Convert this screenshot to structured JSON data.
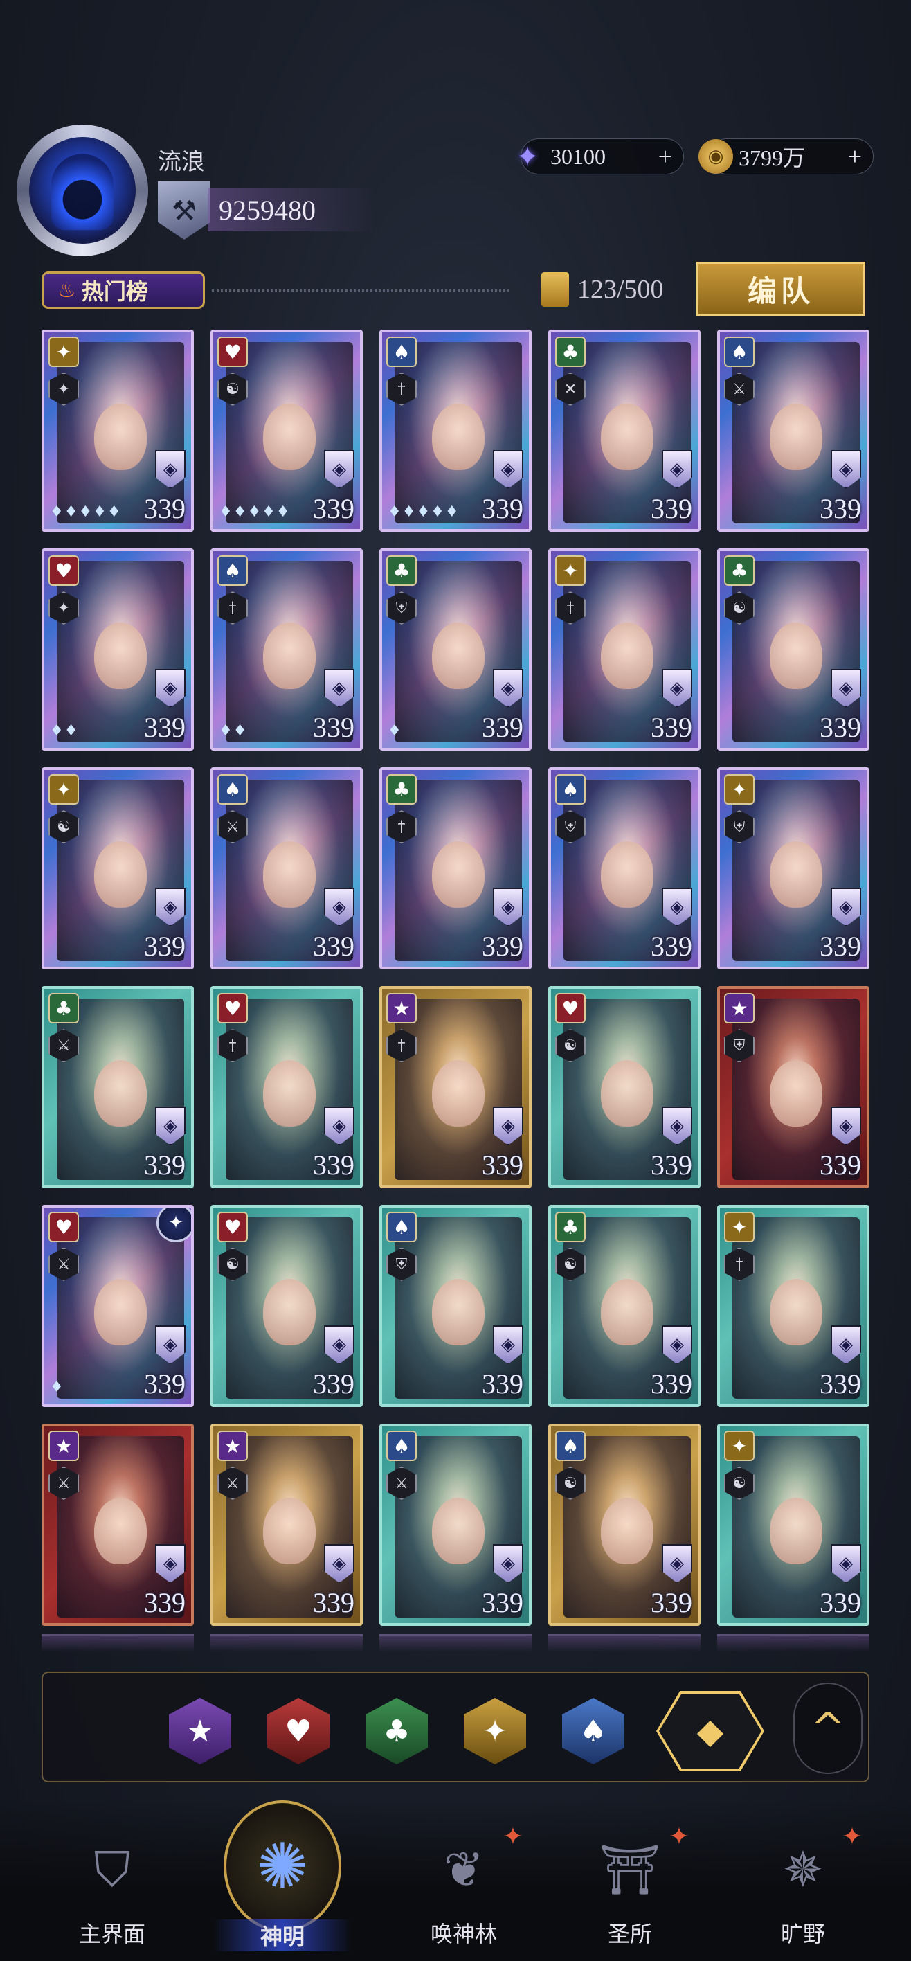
{
  "player": {
    "name": "流浪",
    "power": "9259480",
    "avatar_icon": "hooded-figure"
  },
  "currencies": {
    "crystal": {
      "value": "30100",
      "icon": "crystal-star",
      "plus": "+"
    },
    "gold": {
      "value": "3799万",
      "icon": "gold-coin",
      "plus": "+"
    }
  },
  "toolbar": {
    "hot_label": "热门榜",
    "card_count": "123/500",
    "team_button": "编队"
  },
  "cards": [
    {
      "suit": "diamond",
      "glyph": "✦",
      "frame": "holo",
      "level": "339",
      "pips": "♦♦♦♦♦",
      "cls": "✦"
    },
    {
      "suit": "heart",
      "glyph": "♥",
      "frame": "holo",
      "level": "339",
      "pips": "♦♦♦♦♦",
      "cls": "☯"
    },
    {
      "suit": "spade",
      "glyph": "♠",
      "frame": "holo",
      "level": "339",
      "pips": "♦♦♦♦♦",
      "cls": "†"
    },
    {
      "suit": "club",
      "glyph": "♣",
      "frame": "holo",
      "level": "339",
      "pips": "",
      "cls": "✕"
    },
    {
      "suit": "spade",
      "glyph": "♠",
      "frame": "holo",
      "level": "339",
      "pips": "",
      "cls": "⚔"
    },
    {
      "suit": "heart",
      "glyph": "♥",
      "frame": "holo",
      "level": "339",
      "pips": "♦♦",
      "cls": "✦"
    },
    {
      "suit": "spade",
      "glyph": "♠",
      "frame": "holo",
      "level": "339",
      "pips": "♦♦",
      "cls": "†"
    },
    {
      "suit": "club",
      "glyph": "♣",
      "frame": "holo",
      "level": "339",
      "pips": "♦",
      "cls": "⛨"
    },
    {
      "suit": "diamond",
      "glyph": "✦",
      "frame": "holo",
      "level": "339",
      "pips": "",
      "cls": "†"
    },
    {
      "suit": "club",
      "glyph": "♣",
      "frame": "holo",
      "level": "339",
      "pips": "",
      "cls": "☯"
    },
    {
      "suit": "diamond",
      "glyph": "✦",
      "frame": "holo",
      "level": "339",
      "pips": "",
      "cls": "☯"
    },
    {
      "suit": "spade",
      "glyph": "♠",
      "frame": "holo",
      "level": "339",
      "pips": "",
      "cls": "⚔"
    },
    {
      "suit": "club",
      "glyph": "♣",
      "frame": "holo",
      "level": "339",
      "pips": "",
      "cls": "†"
    },
    {
      "suit": "spade",
      "glyph": "♠",
      "frame": "holo",
      "level": "339",
      "pips": "",
      "cls": "⛨"
    },
    {
      "suit": "diamond",
      "glyph": "✦",
      "frame": "holo",
      "level": "339",
      "pips": "",
      "cls": "⛨"
    },
    {
      "suit": "club",
      "glyph": "♣",
      "frame": "teal",
      "level": "339",
      "pips": "",
      "cls": "⚔"
    },
    {
      "suit": "heart",
      "glyph": "♥",
      "frame": "teal",
      "level": "339",
      "pips": "",
      "cls": "†"
    },
    {
      "suit": "star",
      "glyph": "★",
      "frame": "gold",
      "level": "339",
      "pips": "",
      "cls": "†"
    },
    {
      "suit": "heart",
      "glyph": "♥",
      "frame": "teal",
      "level": "339",
      "pips": "",
      "cls": "☯"
    },
    {
      "suit": "star",
      "glyph": "★",
      "frame": "red",
      "level": "339",
      "pips": "",
      "cls": "⛨"
    },
    {
      "suit": "heart",
      "glyph": "♥",
      "frame": "holo",
      "level": "339",
      "pips": "♦",
      "cls": "⚔",
      "badge": "✦"
    },
    {
      "suit": "heart",
      "glyph": "♥",
      "frame": "teal",
      "level": "339",
      "pips": "",
      "cls": "☯"
    },
    {
      "suit": "spade",
      "glyph": "♠",
      "frame": "teal",
      "level": "339",
      "pips": "",
      "cls": "⛨"
    },
    {
      "suit": "club",
      "glyph": "♣",
      "frame": "teal",
      "level": "339",
      "pips": "",
      "cls": "☯"
    },
    {
      "suit": "diamond",
      "glyph": "✦",
      "frame": "teal",
      "level": "339",
      "pips": "",
      "cls": "†"
    },
    {
      "suit": "star",
      "glyph": "★",
      "frame": "red",
      "level": "339",
      "pips": "",
      "cls": "⚔"
    },
    {
      "suit": "star",
      "glyph": "★",
      "frame": "gold",
      "level": "339",
      "pips": "",
      "cls": "⚔"
    },
    {
      "suit": "spade",
      "glyph": "♠",
      "frame": "teal",
      "level": "339",
      "pips": "",
      "cls": "⚔"
    },
    {
      "suit": "spade",
      "glyph": "♠",
      "frame": "gold",
      "level": "339",
      "pips": "",
      "cls": "☯"
    },
    {
      "suit": "diamond",
      "glyph": "✦",
      "frame": "teal",
      "level": "339",
      "pips": "",
      "cls": "☯"
    }
  ],
  "filters": {
    "star": "★",
    "heart": "♥",
    "club": "♣",
    "diamond": "✦",
    "spade": "♠",
    "all": "◆",
    "collapse": "^"
  },
  "nav": {
    "home": "主界面",
    "gods": "神明",
    "summon": "唤神林",
    "sanctuary": "圣所",
    "wild": "旷野"
  },
  "colors": {
    "accent_gold": "#c9a24a",
    "alert_red": "#e35a3a"
  }
}
